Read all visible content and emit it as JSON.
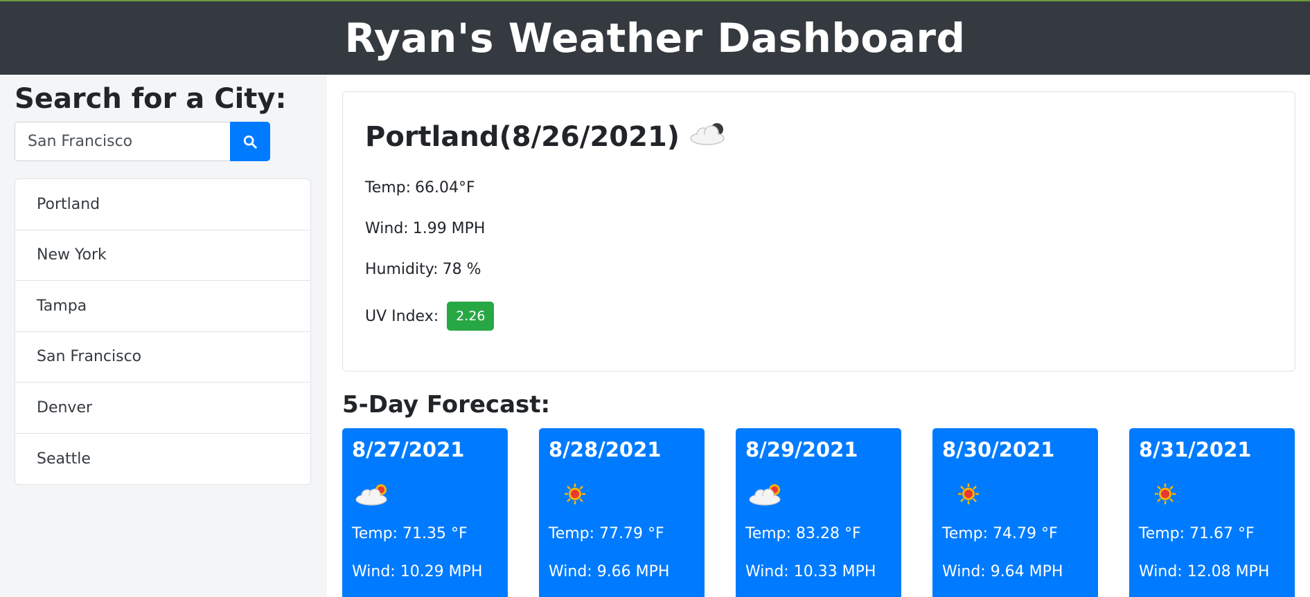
{
  "header": {
    "title": "Ryan's Weather Dashboard"
  },
  "search": {
    "heading": "Search for a City:",
    "value": "San Francisco",
    "button_icon": "search-icon"
  },
  "history": {
    "cities": [
      "Portland",
      "New York",
      "Tampa",
      "San Francisco",
      "Denver",
      "Seattle"
    ]
  },
  "current": {
    "title": "Portland(8/26/2021)",
    "icon": "cloud-icon",
    "temp_label": "Temp:",
    "temp_value": "66.04°F",
    "wind_label": "Wind:",
    "wind_value": "1.99 MPH",
    "humidity_label": "Humidity:",
    "humidity_value": "78 %",
    "uv_label": "UV Index:",
    "uv_value": "2.26",
    "uv_color": "#28a745"
  },
  "forecast": {
    "heading": "5-Day Forecast:",
    "days": [
      {
        "date": "8/27/2021",
        "icon": "partly-cloudy-icon",
        "temp": "Temp: 71.35 °F",
        "wind": "Wind: 10.29 MPH"
      },
      {
        "date": "8/28/2021",
        "icon": "sun-icon",
        "temp": "Temp: 77.79 °F",
        "wind": "Wind: 9.66 MPH"
      },
      {
        "date": "8/29/2021",
        "icon": "partly-cloudy-icon",
        "temp": "Temp: 83.28 °F",
        "wind": "Wind: 10.33 MPH"
      },
      {
        "date": "8/30/2021",
        "icon": "sun-icon",
        "temp": "Temp: 74.79 °F",
        "wind": "Wind: 9.64 MPH"
      },
      {
        "date": "8/31/2021",
        "icon": "sun-icon",
        "temp": "Temp: 71.67 °F",
        "wind": "Wind: 12.08 MPH"
      }
    ]
  },
  "colors": {
    "header_bg": "#343a40",
    "accent": "#007bff",
    "uv_good": "#28a745"
  }
}
